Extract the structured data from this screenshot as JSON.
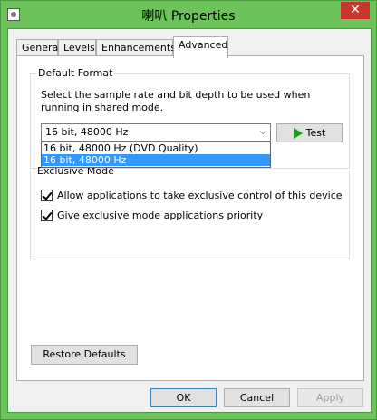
{
  "window": {
    "title": "喇叭 Properties",
    "close_glyph": "✕"
  },
  "tabs": [
    {
      "label": "General"
    },
    {
      "label": "Levels"
    },
    {
      "label": "Enhancements"
    },
    {
      "label": "Advanced",
      "active": true
    }
  ],
  "default_format": {
    "group_label": "Default Format",
    "description": "Select the sample rate and bit depth to be used when running in shared mode.",
    "selected": "16 bit, 48000 Hz",
    "options": [
      "16 bit, 48000 Hz (DVD Quality)",
      "16 bit, 48000 Hz"
    ],
    "highlighted_index": 1,
    "test_label": "Test"
  },
  "exclusive_mode": {
    "group_label": "Exclusive Mode",
    "options": [
      {
        "label": "Allow applications to take exclusive control of this device",
        "checked": true
      },
      {
        "label": "Give exclusive mode applications priority",
        "checked": true
      }
    ]
  },
  "restore_label": "Restore Defaults",
  "buttons": {
    "ok": "OK",
    "cancel": "Cancel",
    "apply": "Apply"
  },
  "colors": {
    "accent": "#6cc35a",
    "close": "#c7372f",
    "selection": "#3399ff",
    "play": "#1e9a1e"
  }
}
